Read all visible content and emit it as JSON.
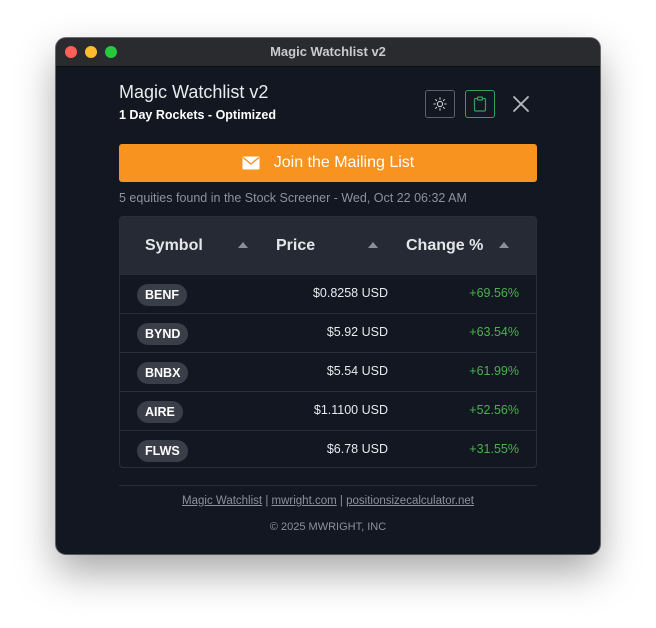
{
  "window": {
    "title": "Magic Watchlist v2"
  },
  "header": {
    "title": "Magic Watchlist v2",
    "subtitle": "1 Day Rockets - Optimized",
    "icons": {
      "theme": "sun-icon",
      "clipboard": "clipboard-icon",
      "close": "close-icon"
    }
  },
  "mailing": {
    "label": "Join the Mailing List",
    "icon": "envelope-icon",
    "color": "#f7931e"
  },
  "status_text": "5 equities found in the Stock Screener - Wed, Oct 22 06:32 AM",
  "table": {
    "columns": [
      "Symbol",
      "Price",
      "Change %"
    ],
    "rows": [
      {
        "symbol": "BENF",
        "price": "$0.8258 USD",
        "change": "+69.56%"
      },
      {
        "symbol": "BYND",
        "price": "$5.92 USD",
        "change": "+63.54%"
      },
      {
        "symbol": "BNBX",
        "price": "$5.54 USD",
        "change": "+61.99%"
      },
      {
        "symbol": "AIRE",
        "price": "$1.1100 USD",
        "change": "+52.56%"
      },
      {
        "symbol": "FLWS",
        "price": "$6.78 USD",
        "change": "+31.55%"
      }
    ],
    "positive_color": "#4caf50"
  },
  "footer": {
    "links": [
      "Magic Watchlist",
      "mwright.com",
      "positionsizecalculator.net"
    ],
    "separator": "|",
    "copyright": "© 2025 MWRIGHT, INC"
  }
}
